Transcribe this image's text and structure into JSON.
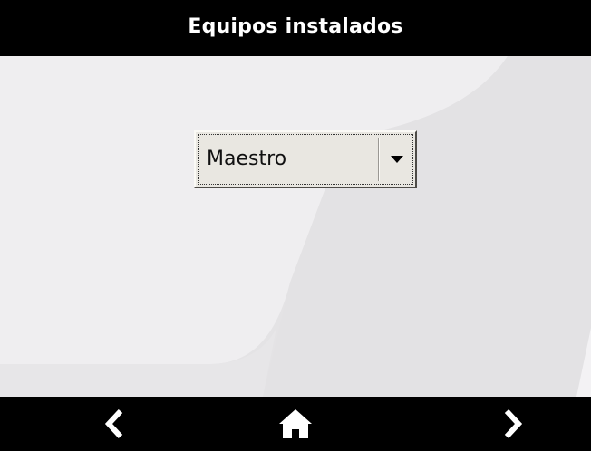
{
  "header": {
    "title": "Equipos instalados"
  },
  "selector": {
    "selected_value": "Maestro",
    "icon": "triangle-down-icon"
  },
  "nav": {
    "back_icon": "chevron-left-icon",
    "home_icon": "home-icon",
    "next_icon": "chevron-right-icon"
  },
  "colors": {
    "bars": "#000000",
    "title_text": "#ffffff",
    "background_light": "#eeedef",
    "background_dark": "#e3e2e4",
    "dropdown_face": "#e9e7e1",
    "nav_icons": "#ffffff"
  }
}
